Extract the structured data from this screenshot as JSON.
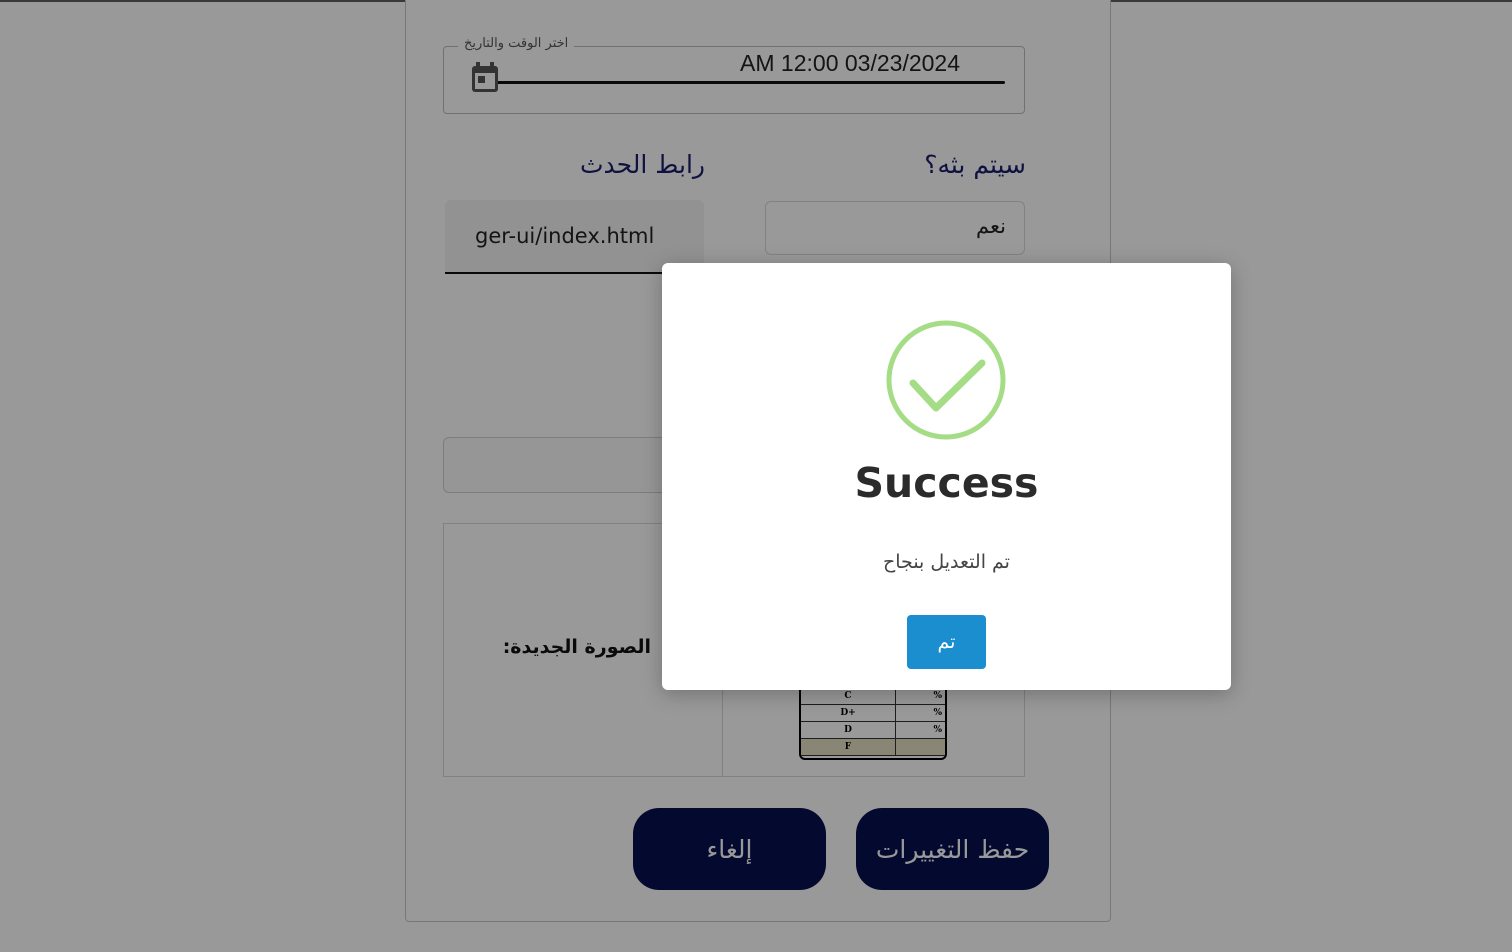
{
  "form": {
    "datetime_legend": "اختر الوقت والتاريخ",
    "datetime_value": "AM 12:00 03/23/2024",
    "event_link_label": "رابط الحدث",
    "event_link_value": "ger-ui/index.html",
    "broadcast_question_label": "سيتم بثه؟",
    "broadcast_value": "نعم",
    "new_image_label": "الصورة الجديدة:",
    "grade_rows": [
      {
        "grade": "C",
        "pct": "%"
      },
      {
        "grade": "D+",
        "pct": "%"
      },
      {
        "grade": "D",
        "pct": "%"
      },
      {
        "grade": "F",
        "pct": ""
      }
    ],
    "cancel_label": "إلغاء",
    "save_label": "حفظ التغييرات"
  },
  "modal": {
    "title": "Success",
    "message": "تم التعديل بنجاح",
    "confirm_label": "تم",
    "icon": "check-circle-icon",
    "accent_color": "#a5dc86",
    "button_color": "#1a8ecf"
  },
  "colors": {
    "primary_dark": "#08104f",
    "label_blue": "#1a1f6b"
  }
}
